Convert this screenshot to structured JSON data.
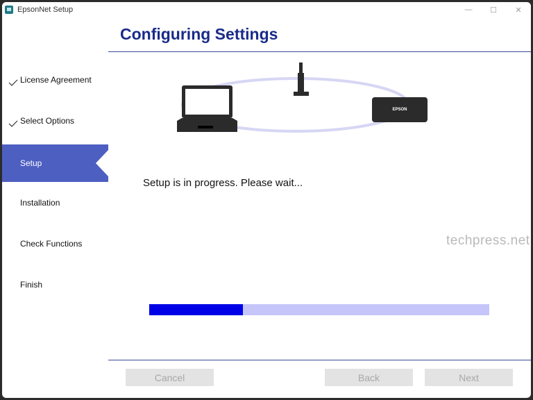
{
  "window": {
    "title": "EpsonNet Setup",
    "controls": {
      "minimize": "—",
      "maximize": "☐",
      "close": "✕"
    }
  },
  "header": {
    "title": "Configuring Settings"
  },
  "steps": [
    {
      "label": "License Agreement",
      "state": "done"
    },
    {
      "label": "Select Options",
      "state": "done"
    },
    {
      "label": "Setup",
      "state": "active"
    },
    {
      "label": "Installation",
      "state": "pending"
    },
    {
      "label": "Check Functions",
      "state": "pending"
    },
    {
      "label": "Finish",
      "state": "pending"
    }
  ],
  "illustration": {
    "printer_brand": "EPSON",
    "icons": [
      "laptop-icon",
      "router-icon",
      "printer-icon"
    ]
  },
  "status": {
    "message": "Setup is in progress. Please wait..."
  },
  "progress": {
    "fraction": 0.275
  },
  "watermark": "techpress.net",
  "buttons": {
    "cancel": "Cancel",
    "back": "Back",
    "next": "Next"
  },
  "colors": {
    "accent": "#4e5fc2",
    "title": "#1a2b8a",
    "progress_fill": "#0000e6",
    "progress_track": "#c5c5f9"
  }
}
